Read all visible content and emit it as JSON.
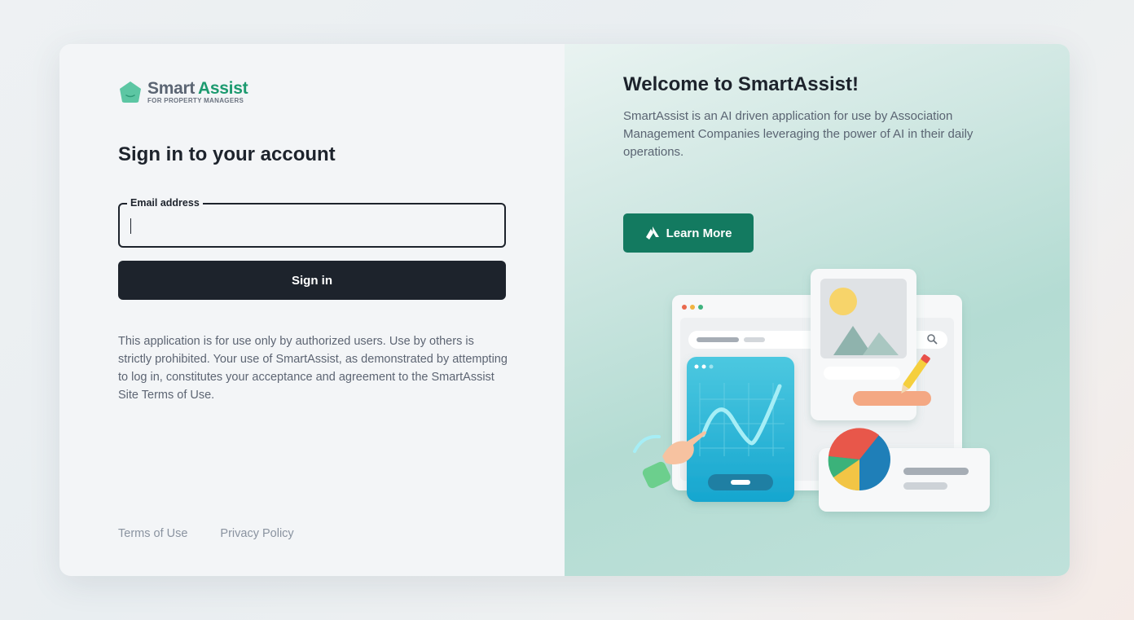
{
  "brand": {
    "word1": "Smart",
    "word2": "Assist",
    "tagline": "FOR PROPERTY MANAGERS",
    "color_primary": "#1c9a6f"
  },
  "signin": {
    "title": "Sign in to your account",
    "email_label": "Email address",
    "email_value": "",
    "button_label": "Sign in",
    "notice": "This application is for use only by authorized users. Use by others is strictly prohibited. Your use of SmartAssist, as demonstrated by attempting to log in, constitutes your acceptance and agreement to the SmartAssist Site Terms of Use."
  },
  "footer": {
    "terms_label": "Terms of Use",
    "privacy_label": "Privacy Policy"
  },
  "hero": {
    "title": "Welcome to SmartAssist!",
    "description": "SmartAssist is an AI driven application for use by Association Management Companies leveraging the power of AI in their daily operations.",
    "button_label": "Learn More",
    "button_icon": "smartassist-logo-icon",
    "button_color": "#137a60"
  }
}
